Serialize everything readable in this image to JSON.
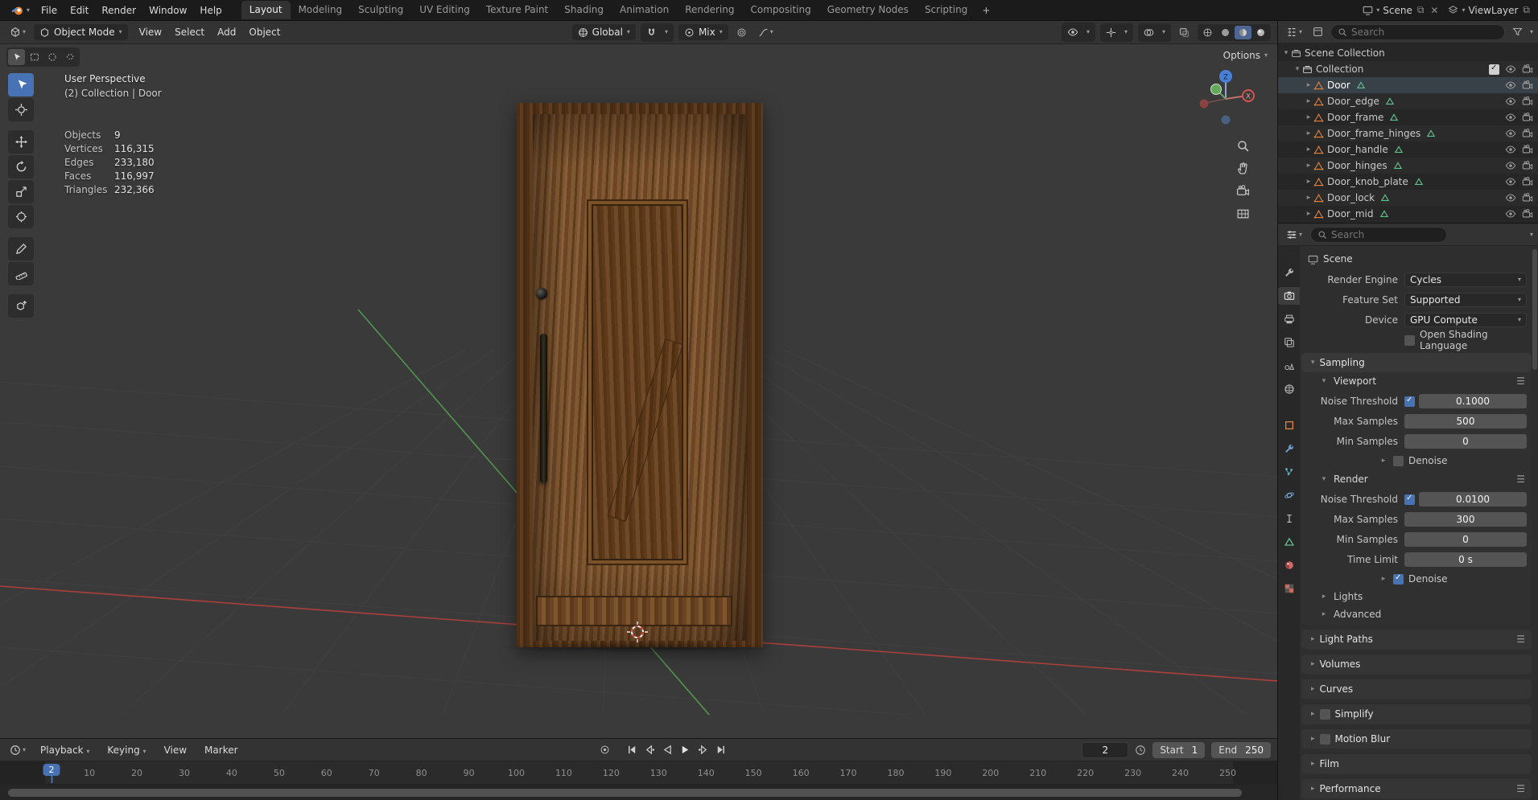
{
  "topbar": {
    "menus": [
      "File",
      "Edit",
      "Render",
      "Window",
      "Help"
    ],
    "workspaces": [
      "Layout",
      "Modeling",
      "Sculpting",
      "UV Editing",
      "Texture Paint",
      "Shading",
      "Animation",
      "Rendering",
      "Compositing",
      "Geometry Nodes",
      "Scripting"
    ],
    "add_tab": "+",
    "scene_name": "Scene",
    "view_layer_name": "ViewLayer"
  },
  "viewport": {
    "mode_selector": "Object Mode",
    "menus": [
      "View",
      "Select",
      "Add",
      "Object"
    ],
    "transform_orientation": "Global",
    "falloff": "Mix",
    "options": "Options",
    "view_name": "User Perspective",
    "context_path": "(2) Collection | Door",
    "stats": [
      {
        "label": "Objects",
        "value": "9"
      },
      {
        "label": "Vertices",
        "value": "116,315"
      },
      {
        "label": "Edges",
        "value": "233,180"
      },
      {
        "label": "Faces",
        "value": "116,997"
      },
      {
        "label": "Triangles",
        "value": "232,366"
      }
    ],
    "axis_labels": {
      "x": "X",
      "z": "Z"
    }
  },
  "timeline": {
    "menus": [
      "Playback",
      "Keying",
      "View",
      "Marker"
    ],
    "frame_field": "2",
    "playhead": "2",
    "start_label": "Start",
    "start_value": "1",
    "end_label": "End",
    "end_value": "250",
    "ticks": [
      10,
      20,
      30,
      40,
      50,
      60,
      70,
      80,
      90,
      100,
      110,
      120,
      130,
      140,
      150,
      160,
      170,
      180,
      190,
      200,
      210,
      220,
      230,
      240,
      250
    ]
  },
  "outliner": {
    "search_placeholder": "Search",
    "scene_collection": "Scene Collection",
    "collection": "Collection",
    "objects": [
      "Door",
      "Door_edge",
      "Door_frame",
      "Door_frame_hinges",
      "Door_handle",
      "Door_hinges",
      "Door_knob_plate",
      "Door_lock",
      "Door_mid"
    ]
  },
  "properties": {
    "search_placeholder": "Search",
    "breadcrumb": "Scene",
    "render_engine": {
      "label": "Render Engine",
      "value": "Cycles"
    },
    "feature_set": {
      "label": "Feature Set",
      "value": "Supported"
    },
    "device": {
      "label": "Device",
      "value": "GPU Compute"
    },
    "osl": {
      "label": "Open Shading Language"
    },
    "sampling": {
      "title": "Sampling",
      "viewport": {
        "title": "Viewport",
        "noise_threshold": {
          "label": "Noise Threshold",
          "value": "0.1000"
        },
        "max_samples": {
          "label": "Max Samples",
          "value": "500"
        },
        "min_samples": {
          "label": "Min Samples",
          "value": "0"
        },
        "denoise": {
          "label": "Denoise"
        }
      },
      "render": {
        "title": "Render",
        "noise_threshold": {
          "label": "Noise Threshold",
          "value": "0.0100"
        },
        "max_samples": {
          "label": "Max Samples",
          "value": "300"
        },
        "min_samples": {
          "label": "Min Samples",
          "value": "0"
        },
        "time_limit": {
          "label": "Time Limit",
          "value": "0 s"
        },
        "denoise": {
          "label": "Denoise"
        }
      },
      "lights": "Lights",
      "advanced": "Advanced"
    },
    "collapsed_panels": [
      "Light Paths",
      "Volumes",
      "Curves",
      "Simplify",
      "Motion Blur",
      "Film",
      "Performance"
    ]
  },
  "colors": {
    "accent_blue": "#4772b3",
    "mesh_orange": "#e0823d",
    "data_green": "#5fc08b",
    "axis_red": "#c24340",
    "axis_green": "#5aa54e",
    "axis_blue": "#3f6fc1"
  }
}
